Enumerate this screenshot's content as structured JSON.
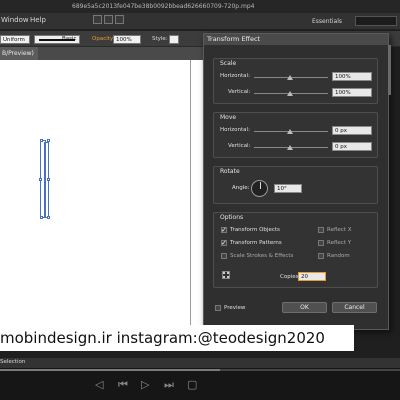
{
  "window": {
    "video_title": "689e5a5c2013fe047be38b0092bbead626660709-720p.mp4",
    "menus": [
      "Window",
      "Help"
    ],
    "workspace": "Essentials"
  },
  "control_bar": {
    "uniform": "Uniform",
    "basic": "Basic",
    "opacity_label": "Opacity:",
    "opacity_value": "100%",
    "style_label": "Style:"
  },
  "document": {
    "tab_label": "B/Preview)"
  },
  "dialog": {
    "title": "Transform Effect",
    "scale": {
      "title": "Scale",
      "horizontal_label": "Horizontal:",
      "horizontal_value": "100%",
      "vertical_label": "Vertical:",
      "vertical_value": "100%"
    },
    "move": {
      "title": "Move",
      "horizontal_label": "Horizontal:",
      "horizontal_value": "0 px",
      "vertical_label": "Vertical:",
      "vertical_value": "0 px"
    },
    "rotate": {
      "title": "Rotate",
      "angle_label": "Angle:",
      "angle_value": "10°"
    },
    "options": {
      "title": "Options",
      "transform_objects": {
        "label": "Transform Objects",
        "checked": true
      },
      "transform_patterns": {
        "label": "Transform Patterns",
        "checked": true
      },
      "scale_strokes": {
        "label": "Scale Strokes & Effects",
        "checked": false
      },
      "reflect_x": {
        "label": "Reflect X",
        "checked": false
      },
      "reflect_y": {
        "label": "Reflect Y",
        "checked": false
      },
      "random": {
        "label": "Random",
        "checked": false
      },
      "copies_label": "Copies",
      "copies_value": "20"
    },
    "preview": {
      "label": "Preview",
      "checked": false
    },
    "ok_label": "OK",
    "cancel_label": "Cancel"
  },
  "watermark": {
    "text": "mobindesign.ir  instagram:@teodesign2020"
  },
  "status": {
    "tool": "Selection"
  },
  "player": {
    "progress": 0.55
  }
}
